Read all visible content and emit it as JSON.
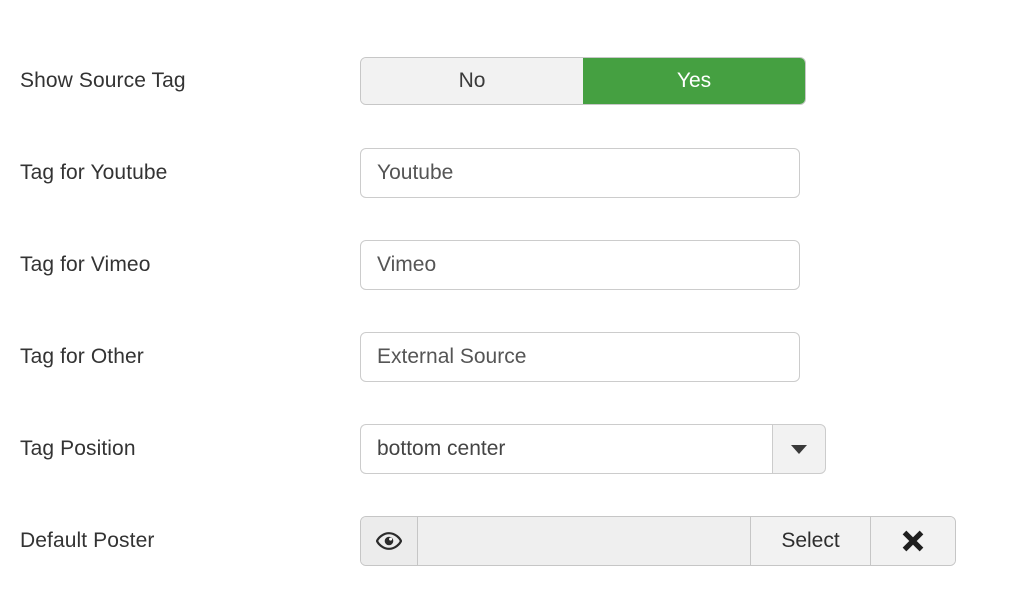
{
  "theme": {
    "accent_green": "#45a041",
    "label_color": "#333333",
    "input_border": "#cccccc",
    "control_bg": "#f2f2f2",
    "disabled_bg": "#efefef"
  },
  "form": {
    "rows": [
      {
        "label": "Show Source Tag",
        "type": "toggle",
        "options": [
          "No",
          "Yes"
        ],
        "selected": "Yes"
      },
      {
        "label": "Tag for Youtube",
        "type": "text",
        "value": "Youtube",
        "placeholder": "Youtube"
      },
      {
        "label": "Tag for Vimeo",
        "type": "text",
        "value": "Vimeo",
        "placeholder": "Vimeo"
      },
      {
        "label": "Tag for Other",
        "type": "text",
        "value": "External Source",
        "placeholder": "External Source"
      },
      {
        "label": "Tag Position",
        "type": "select",
        "value": "bottom center"
      },
      {
        "label": "Default Poster",
        "type": "file",
        "value": "",
        "placeholder": "",
        "select_label": "Select",
        "preview_icon": "eye-icon",
        "clear_icon": "close-x-icon"
      }
    ]
  }
}
